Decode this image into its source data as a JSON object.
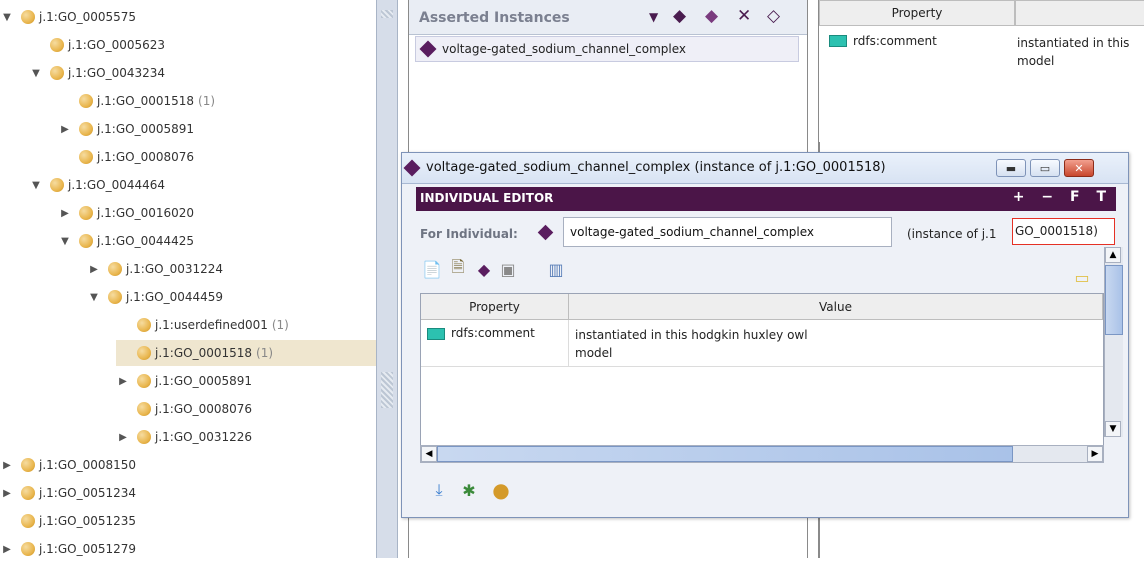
{
  "class_tree": {
    "rows": [
      {
        "label": "j.1:GO_0005575",
        "count": "",
        "toggle": "expanded",
        "depth": 0
      },
      {
        "label": "j.1:GO_0005623",
        "count": "",
        "toggle": "none",
        "depth": 1
      },
      {
        "label": "j.1:GO_0043234",
        "count": "",
        "toggle": "expanded",
        "depth": 1
      },
      {
        "label": "j.1:GO_0001518",
        "count": "(1)",
        "toggle": "none",
        "depth": 2
      },
      {
        "label": "j.1:GO_0005891",
        "count": "",
        "toggle": "collapsed",
        "depth": 2
      },
      {
        "label": "j.1:GO_0008076",
        "count": "",
        "toggle": "none",
        "depth": 2
      },
      {
        "label": "j.1:GO_0044464",
        "count": "",
        "toggle": "expanded",
        "depth": 1
      },
      {
        "label": "j.1:GO_0016020",
        "count": "",
        "toggle": "collapsed",
        "depth": 2
      },
      {
        "label": "j.1:GO_0044425",
        "count": "",
        "toggle": "expanded",
        "depth": 2
      },
      {
        "label": "j.1:GO_0031224",
        "count": "",
        "toggle": "collapsed",
        "depth": 3
      },
      {
        "label": "j.1:GO_0044459",
        "count": "",
        "toggle": "expanded",
        "depth": 3
      },
      {
        "label": "j.1:userdefined001",
        "count": "(1)",
        "toggle": "none",
        "depth": 4
      },
      {
        "label": "j.1:GO_0001518",
        "count": "(1)",
        "toggle": "none",
        "depth": 4,
        "selected": true
      },
      {
        "label": "j.1:GO_0005891",
        "count": "",
        "toggle": "collapsed",
        "depth": 4
      },
      {
        "label": "j.1:GO_0008076",
        "count": "",
        "toggle": "none",
        "depth": 4
      },
      {
        "label": "j.1:GO_0031226",
        "count": "",
        "toggle": "collapsed",
        "depth": 4
      },
      {
        "label": "j.1:GO_0008150",
        "count": "",
        "toggle": "collapsed",
        "depth": 0
      },
      {
        "label": "j.1:GO_0051234",
        "count": "",
        "toggle": "collapsed",
        "depth": 0
      },
      {
        "label": "j.1:GO_0051235",
        "count": "",
        "toggle": "none",
        "depth": 0
      },
      {
        "label": "j.1:GO_0051279",
        "count": "",
        "toggle": "collapsed",
        "depth": 0
      }
    ]
  },
  "instances_pane": {
    "title": "Asserted Instances",
    "items": [
      "voltage-gated_sodium_channel_complex"
    ]
  },
  "right_pane": {
    "header_property": "Property",
    "row_property": "rdfs:comment",
    "row_value_line1": "instantiated in this",
    "row_value_line2": "model"
  },
  "editor": {
    "window_title": "voltage-gated_sodium_channel_complex  (instance of j.1:GO_0001518)",
    "bar_title": "INDIVIDUAL EDITOR",
    "bar_icons": "+ − F T",
    "for_individual_label": "For Individual:",
    "name_value": "voltage-gated_sodium_channel_complex",
    "instance_of_text": "(instance of j.1",
    "instance_of_class": "GO_0001518)",
    "col_property": "Property",
    "col_value": "Value",
    "rows": [
      {
        "property": "rdfs:comment",
        "value_line1": "instantiated in this hodgkin huxley owl",
        "value_line2": "model"
      }
    ]
  },
  "colors": {
    "accent_purple": "#4b1548",
    "selection": "#efe6cf",
    "class_ball": "#e9b64e",
    "highlight_border": "#e53125"
  }
}
